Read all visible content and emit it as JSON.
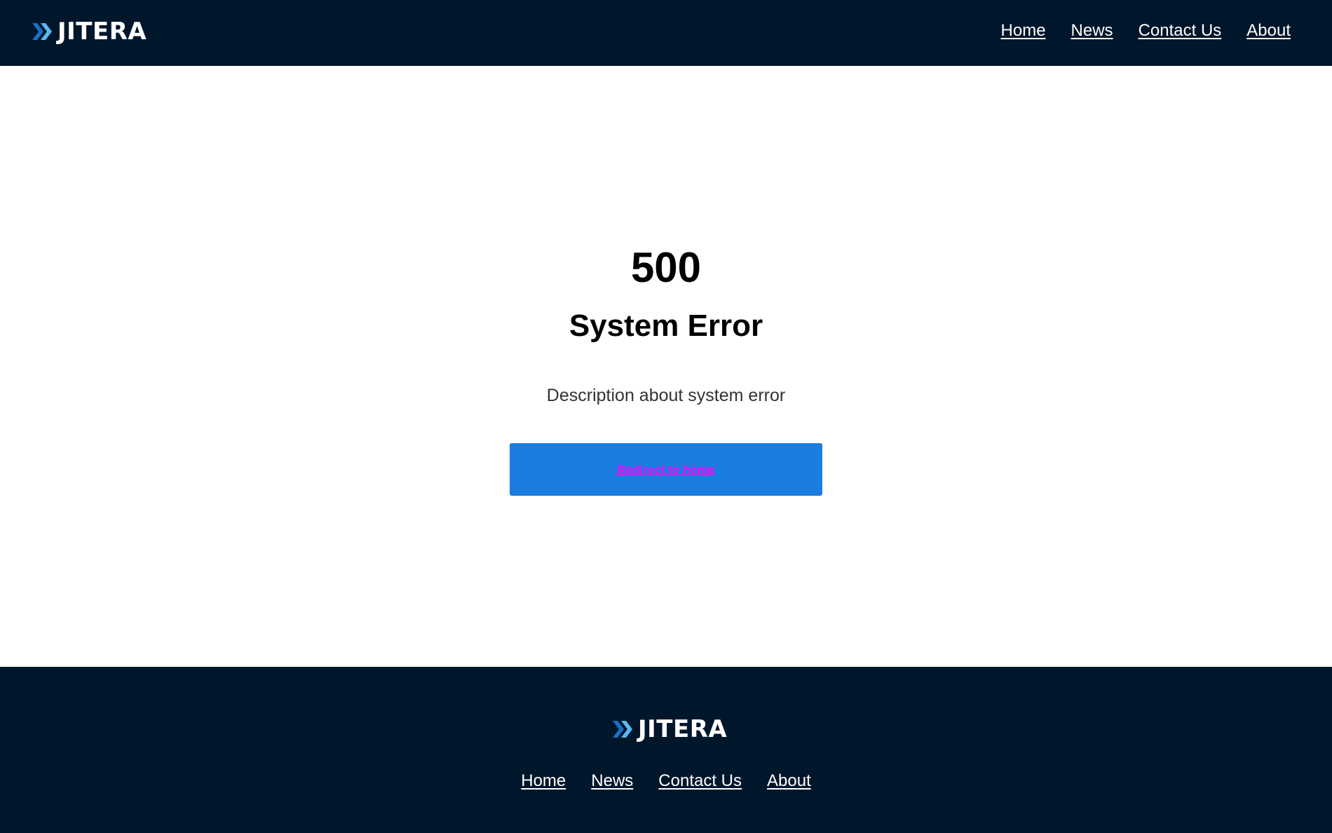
{
  "header": {
    "logo_text": "JITERA",
    "nav": [
      "Home",
      "News",
      "Contact Us",
      "About"
    ]
  },
  "main": {
    "error_code": "500",
    "error_title": "System Error",
    "error_description": "Description about system error",
    "button_label": "Redirect to home"
  },
  "footer": {
    "logo_text": "JITERA",
    "nav": [
      "Home",
      "News",
      "Contact Us",
      "About"
    ]
  },
  "colors": {
    "header_bg": "#00162b",
    "button_bg": "#1a7ddf",
    "button_text": "#ff00ff",
    "logo_chevron_dark": "#1a6fc4",
    "logo_chevron_light": "#5bb8f0"
  }
}
